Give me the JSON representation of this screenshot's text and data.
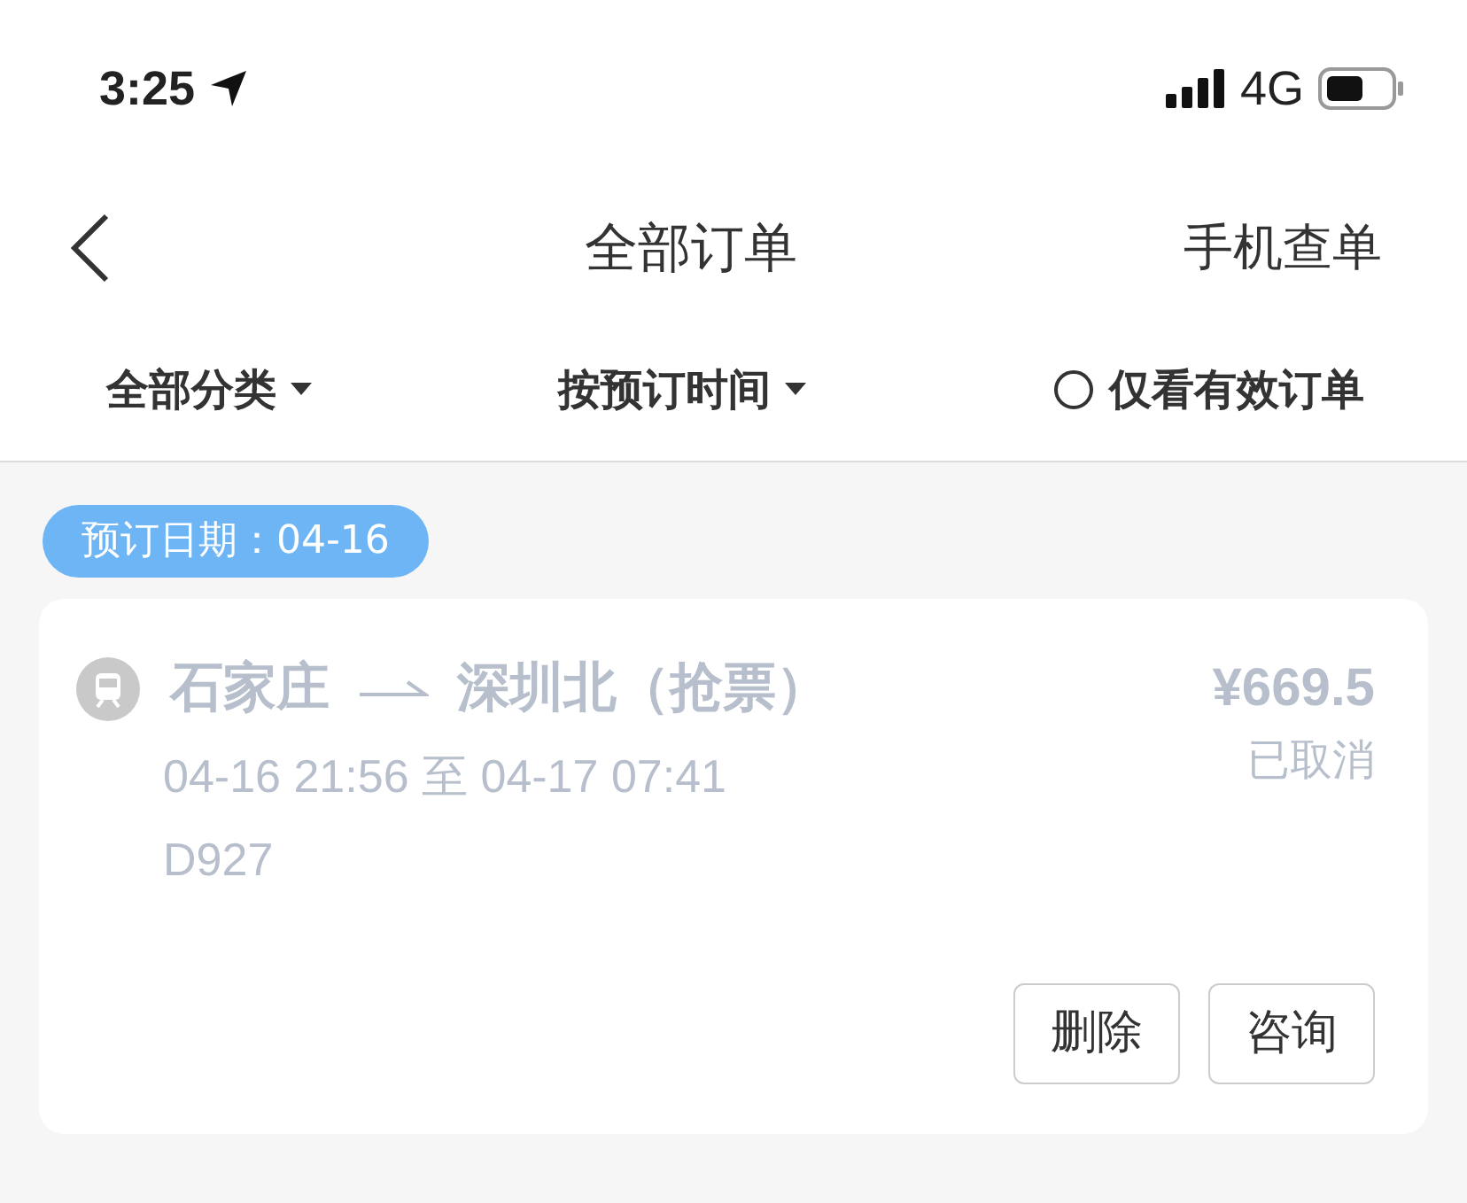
{
  "status_bar": {
    "time": "3:25",
    "network": "4G"
  },
  "nav": {
    "title": "全部订单",
    "action": "手机查单"
  },
  "filters": [
    {
      "kind": "dropdown",
      "label": "全部分类"
    },
    {
      "kind": "dropdown",
      "label": "按预订时间"
    },
    {
      "kind": "toggle",
      "label": "仅看有效订单",
      "checked": false
    }
  ],
  "orders": [
    {
      "date_badge": "预订日期：04-16",
      "from": "石家庄",
      "to": "深圳北（抢票）",
      "price": "¥669.5",
      "status": "已取消",
      "cancelled": true,
      "schedule": "04-16 21:56 至 04-17 07:41",
      "train": "D927",
      "buttons": [
        "删除",
        "咨询"
      ]
    }
  ]
}
